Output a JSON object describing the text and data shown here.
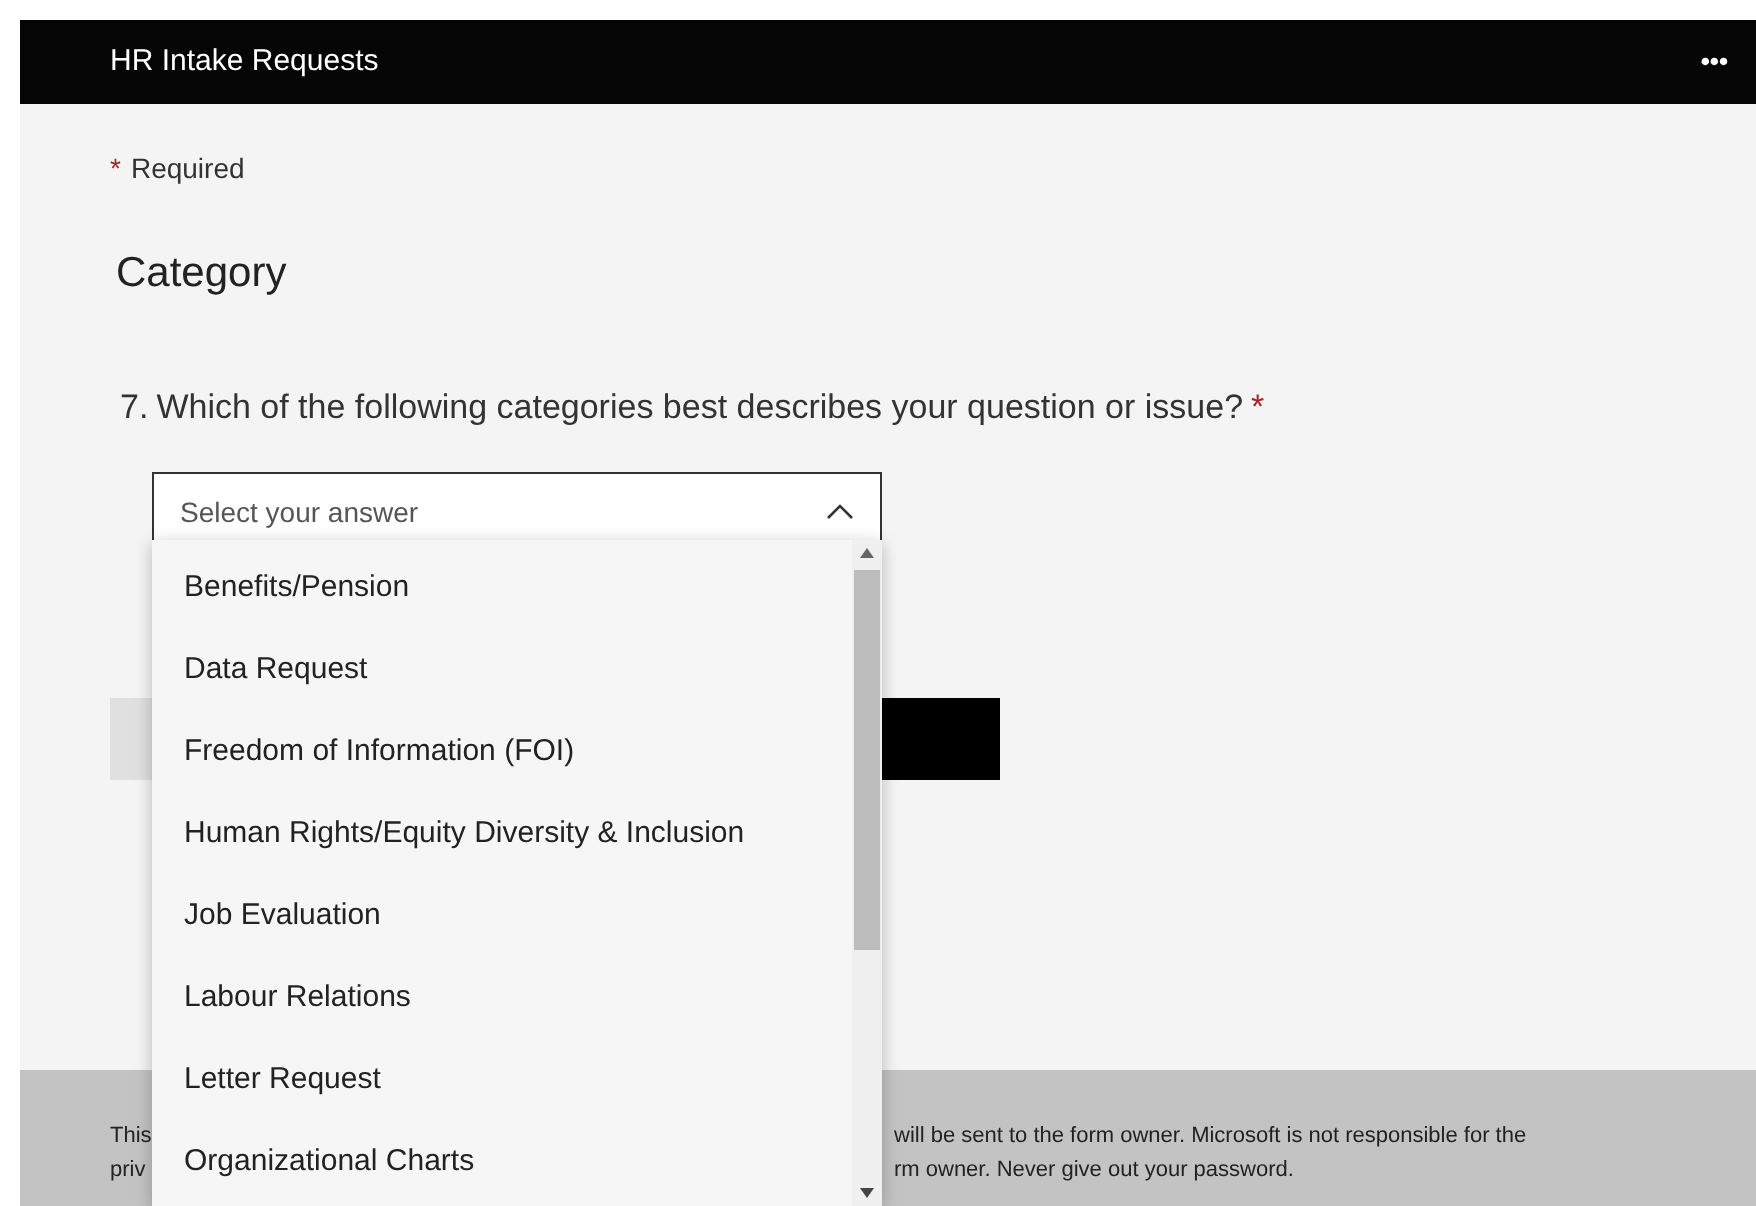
{
  "window": {
    "title": "HR Intake Requests",
    "menu": "•••"
  },
  "required_note": {
    "mark": "*",
    "text": "Required"
  },
  "section": {
    "title": "Category"
  },
  "question": {
    "number": "7.",
    "text": "Which of the following categories best describes your question or issue?",
    "required_mark": "*"
  },
  "dropdown": {
    "placeholder": "Select your answer",
    "expanded": true,
    "options": [
      {
        "label": "Benefits/Pension",
        "selected": false
      },
      {
        "label": "Data Request",
        "selected": false
      },
      {
        "label": "Freedom of Information (FOI)",
        "selected": false
      },
      {
        "label": "Human Rights/Equity Diversity & Inclusion",
        "selected": false
      },
      {
        "label": "Job Evaluation",
        "selected": false
      },
      {
        "label": "Labour Relations",
        "selected": false
      },
      {
        "label": "Letter Request",
        "selected": false
      },
      {
        "label": "Organizational Charts",
        "selected": false
      }
    ]
  },
  "footer": {
    "line_1_start": "This",
    "line_1_end": "will be sent to the form owner. Microsoft is not responsible for the",
    "line_2_start": "priv",
    "line_2_end": "rm owner. Never give out your password."
  }
}
